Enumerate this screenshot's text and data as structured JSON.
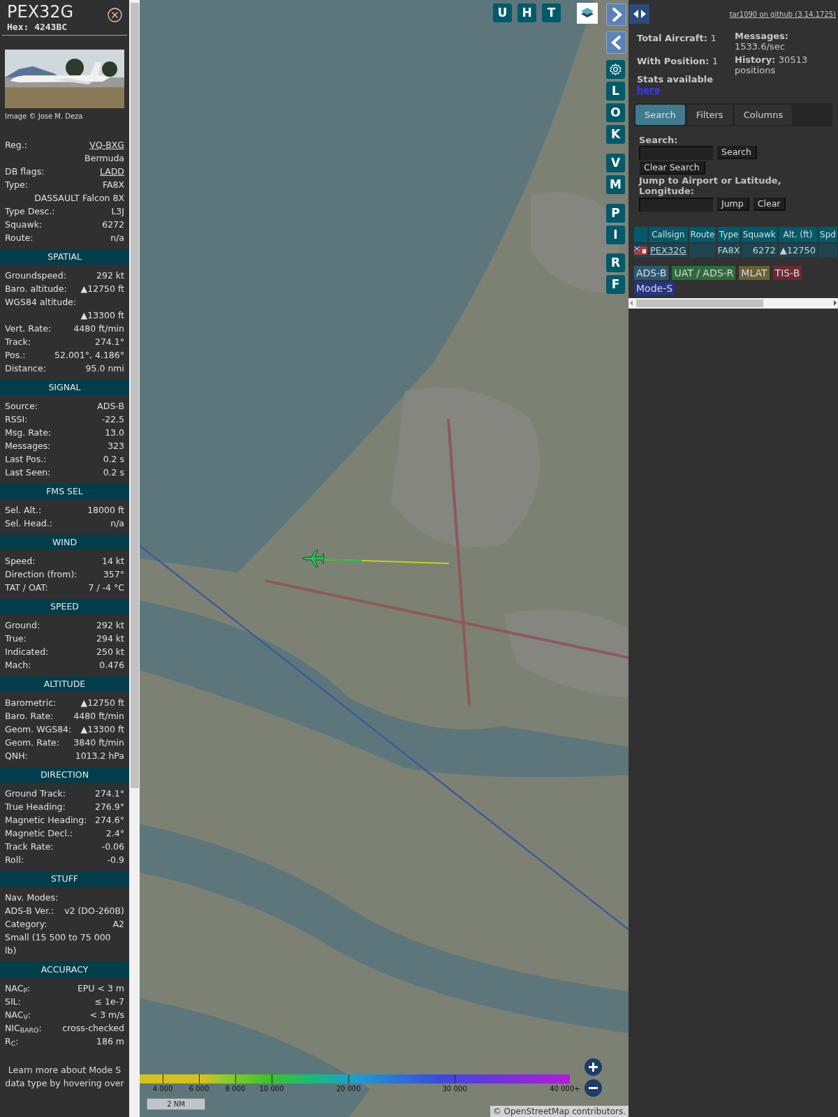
{
  "infobox": {
    "callsign": "PEX32G",
    "hex": "Hex: 4243BC",
    "photo_credit": "Image © Jose M. Deza",
    "rows": [
      {
        "label": "Reg.:",
        "value": "VQ-BXG",
        "link": true
      },
      {
        "value": "Bermuda"
      },
      {
        "label": "DB flags:",
        "value": "LADD",
        "link": true
      },
      {
        "label": "Type:",
        "value": "FA8X"
      },
      {
        "value": "DASSAULT Falcon 8X"
      },
      {
        "label": "Type Desc.:",
        "value": "L3J"
      },
      {
        "label": "Squawk:",
        "value": "6272"
      },
      {
        "label": "Route:",
        "value": "n/a"
      }
    ],
    "sections": [
      {
        "title": "SPATIAL",
        "rows": [
          {
            "label": "Groundspeed:",
            "value": "292 kt"
          },
          {
            "label": "Baro. altitude:",
            "value": "▲12750 ft"
          },
          {
            "label": "WGS84 altitude:"
          },
          {
            "value": "▲13300 ft"
          },
          {
            "label": "Vert. Rate:",
            "value": "4480 ft/min"
          },
          {
            "label": "Track:",
            "value": "274.1°"
          },
          {
            "label": "Pos.:",
            "value": "52.001°, 4.186°"
          },
          {
            "label": "Distance:",
            "value": "95.0 nmi"
          }
        ]
      },
      {
        "title": "SIGNAL",
        "rows": [
          {
            "label": "Source:",
            "value": "ADS-B"
          },
          {
            "label": "RSSI:",
            "value": "-22.5"
          },
          {
            "label": "Msg. Rate:",
            "value": "13.0"
          },
          {
            "label": "Messages:",
            "value": "323"
          },
          {
            "label": "Last Pos.:",
            "value": "0.2 s"
          },
          {
            "label": "Last Seen:",
            "value": "0.2 s"
          }
        ]
      },
      {
        "title": "FMS SEL",
        "rows": [
          {
            "label": "Sel. Alt.:",
            "value": "18000 ft"
          },
          {
            "label": "Sel. Head.:",
            "value": "n/a"
          }
        ]
      },
      {
        "title": "WIND",
        "rows": [
          {
            "label": "Speed:",
            "value": "14 kt"
          },
          {
            "label": "Direction (from):",
            "value": "357°"
          },
          {
            "label": "TAT / OAT:",
            "value": "7 / -4 °C"
          }
        ]
      },
      {
        "title": "SPEED",
        "rows": [
          {
            "label": "Ground:",
            "value": "292 kt"
          },
          {
            "label": "True:",
            "value": "294 kt"
          },
          {
            "label": "Indicated:",
            "value": "250 kt"
          },
          {
            "label": "Mach:",
            "value": "0.476"
          }
        ]
      },
      {
        "title": "ALTITUDE",
        "rows": [
          {
            "label": "Barometric:",
            "value": "▲12750 ft"
          },
          {
            "label": "Baro. Rate:",
            "value": "4480 ft/min"
          },
          {
            "label": "Geom. WGS84:",
            "value": "▲13300 ft"
          },
          {
            "label": "Geom. Rate:",
            "value": "3840 ft/min"
          },
          {
            "label": "QNH:",
            "value": "1013.2 hPa"
          }
        ]
      },
      {
        "title": "DIRECTION",
        "rows": [
          {
            "label": "Ground Track:",
            "value": "274.1°"
          },
          {
            "label": "True Heading:",
            "value": "276.9°"
          },
          {
            "label": "Magnetic Heading:",
            "value": "274.6°"
          },
          {
            "label": "Magnetic Decl.:",
            "value": "2.4°"
          },
          {
            "label": "Track Rate:",
            "value": "-0.06"
          },
          {
            "label": "Roll:",
            "value": "-0.9"
          }
        ]
      },
      {
        "title": "STUFF",
        "rows": [
          {
            "label": "Nav. Modes:"
          },
          {
            "label": "ADS-B Ver.:",
            "value": "v2 (DO-260B)"
          },
          {
            "label": "Category:",
            "value": "A2"
          },
          {
            "label": "Small (15 500 to 75 000 lb)"
          }
        ]
      },
      {
        "title": "ACCURACY",
        "rows": [
          {
            "label": "NAC$_{P}$:",
            "value": "EPU < 3 m"
          },
          {
            "label": "SIL:",
            "value": "≤ 1e-7"
          },
          {
            "label": "NAC$_{V}$:",
            "value": "< 3 m/s"
          },
          {
            "label": "NIC$_{BARO}$:",
            "value": "cross-checked"
          },
          {
            "label": "R$_{C}$:",
            "value": "186 m"
          }
        ]
      }
    ],
    "footer": "Learn more about Mode S data type by hovering over"
  },
  "map": {
    "top_buttons": [
      "U",
      "H",
      "T"
    ],
    "side_buttons": [
      {
        "kind": "arrow-right"
      },
      {
        "kind": "arrow-left"
      },
      {
        "kind": "gear"
      },
      {
        "kind": "letter",
        "label": "L"
      },
      {
        "kind": "letter",
        "label": "O"
      },
      {
        "kind": "letter",
        "label": "K"
      },
      {
        "kind": "letter",
        "label": "V"
      },
      {
        "kind": "letter",
        "label": "M"
      },
      {
        "kind": "letter",
        "label": "P"
      },
      {
        "kind": "letter",
        "label": "I"
      },
      {
        "kind": "letter",
        "label": "R"
      },
      {
        "kind": "letter",
        "label": "F"
      }
    ],
    "altitude_ticks": [
      "4 000",
      "6 000",
      "8 000",
      "10 000",
      "20 000",
      "30 000",
      "40 000+"
    ],
    "scale_bar": "2 NM",
    "attribution": "© OpenStreetMap contributors."
  },
  "right_panel": {
    "github_link": "tar1090 on github (3.14.1725)",
    "total_aircraft": {
      "label": "Total Aircraft:",
      "value": "1"
    },
    "with_position": {
      "label": "With Position:",
      "value": "1"
    },
    "stats": {
      "label": "Stats available",
      "link": "here"
    },
    "messages": {
      "label": "Messages:",
      "value": "1533.6/sec"
    },
    "history": {
      "label": "History:",
      "value": "30513 positions"
    },
    "tabs": [
      {
        "label": "Search",
        "selected": true
      },
      {
        "label": "Filters",
        "selected": false
      },
      {
        "label": "Columns",
        "selected": false
      }
    ],
    "search": {
      "label": "Search:",
      "button": "Search",
      "clear_button": "Clear Search"
    },
    "jump": {
      "label": "Jump to Airport or Latitude, Longitude:",
      "button": "Jump",
      "clear_button": "Clear"
    },
    "table": {
      "columns": [
        "Callsign",
        "Route",
        "Type",
        "Squawk",
        "Alt. (ft)",
        "Spd"
      ],
      "rows": [
        {
          "callsign": "PEX32G",
          "type": "FA8X",
          "squawk": "6272",
          "altitude": "▲12750"
        }
      ]
    },
    "legend": [
      {
        "label": "ADS-B",
        "color": "#2a5a72"
      },
      {
        "label": "UAT / ADS-R",
        "color": "#2e6b3c"
      },
      {
        "label": "MLAT",
        "color": "#6a6034"
      },
      {
        "label": "TIS-B",
        "color": "#6e2830"
      },
      {
        "label": "Mode-S",
        "color": "#263482"
      }
    ]
  }
}
